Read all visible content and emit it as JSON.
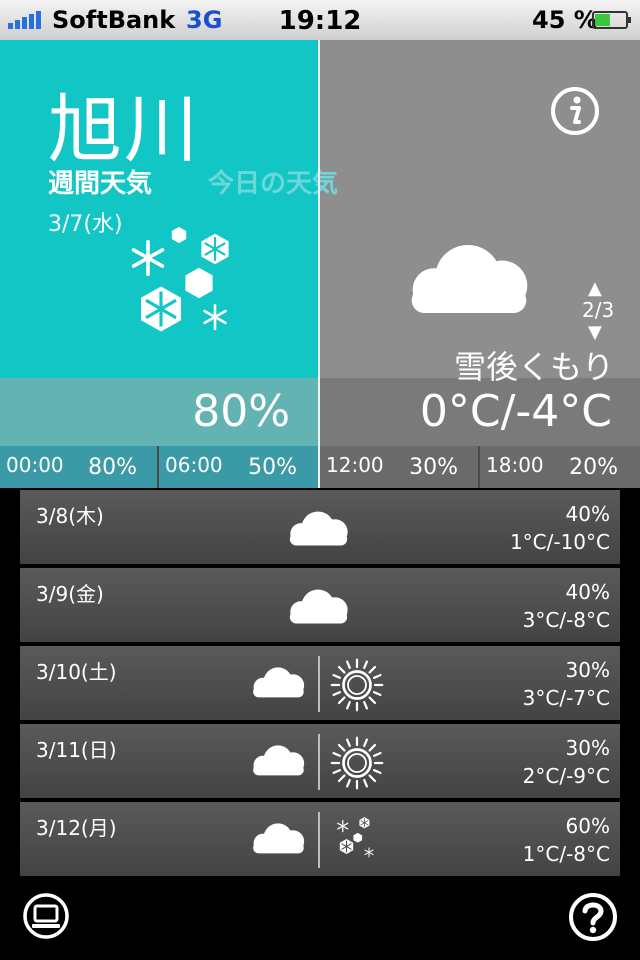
{
  "status_bar": {
    "carrier": "SoftBank",
    "network": "3G",
    "time": "19:12",
    "battery_pct": "45 %",
    "icons": [
      "signal-icon",
      "battery-icon"
    ]
  },
  "header": {
    "city": "旭川",
    "tab_weekly": "週間天気",
    "tab_today": "今日の天気",
    "date": "3/7(水)"
  },
  "today": {
    "condition": "雪後くもり",
    "precip": "80%",
    "temp": "0°C/-4°C",
    "page_up": "▲",
    "page": "2/3",
    "page_down": "▼",
    "icons": [
      "snow-icon",
      "cloud-icon",
      "info-icon"
    ]
  },
  "hourly": [
    {
      "time": "00:00",
      "pct": "80%"
    },
    {
      "time": "06:00",
      "pct": "50%"
    },
    {
      "time": "12:00",
      "pct": "30%"
    },
    {
      "time": "18:00",
      "pct": "20%"
    }
  ],
  "weekly": [
    {
      "date": "3/8(木)",
      "pct": "40%",
      "temp": "1°C/-10°C",
      "icons": [
        "cloud-icon"
      ]
    },
    {
      "date": "3/9(金)",
      "pct": "40%",
      "temp": "3°C/-8°C",
      "icons": [
        "cloud-icon"
      ]
    },
    {
      "date": "3/10(土)",
      "pct": "30%",
      "temp": "3°C/-7°C",
      "icons": [
        "cloud-icon",
        "sun-icon"
      ]
    },
    {
      "date": "3/11(日)",
      "pct": "30%",
      "temp": "2°C/-9°C",
      "icons": [
        "cloud-icon",
        "sun-icon"
      ]
    },
    {
      "date": "3/12(月)",
      "pct": "60%",
      "temp": "1°C/-8°C",
      "icons": [
        "cloud-icon",
        "snow-icon"
      ]
    }
  ],
  "toolbar": {
    "icons": [
      "pc-icon",
      "help-icon"
    ]
  },
  "colors": {
    "accent_cyan": "#13c6c6",
    "panel_gray": "#8e8e8e",
    "list_gray": "#4e4e4e",
    "tab_inactive": "#6ed7da"
  }
}
